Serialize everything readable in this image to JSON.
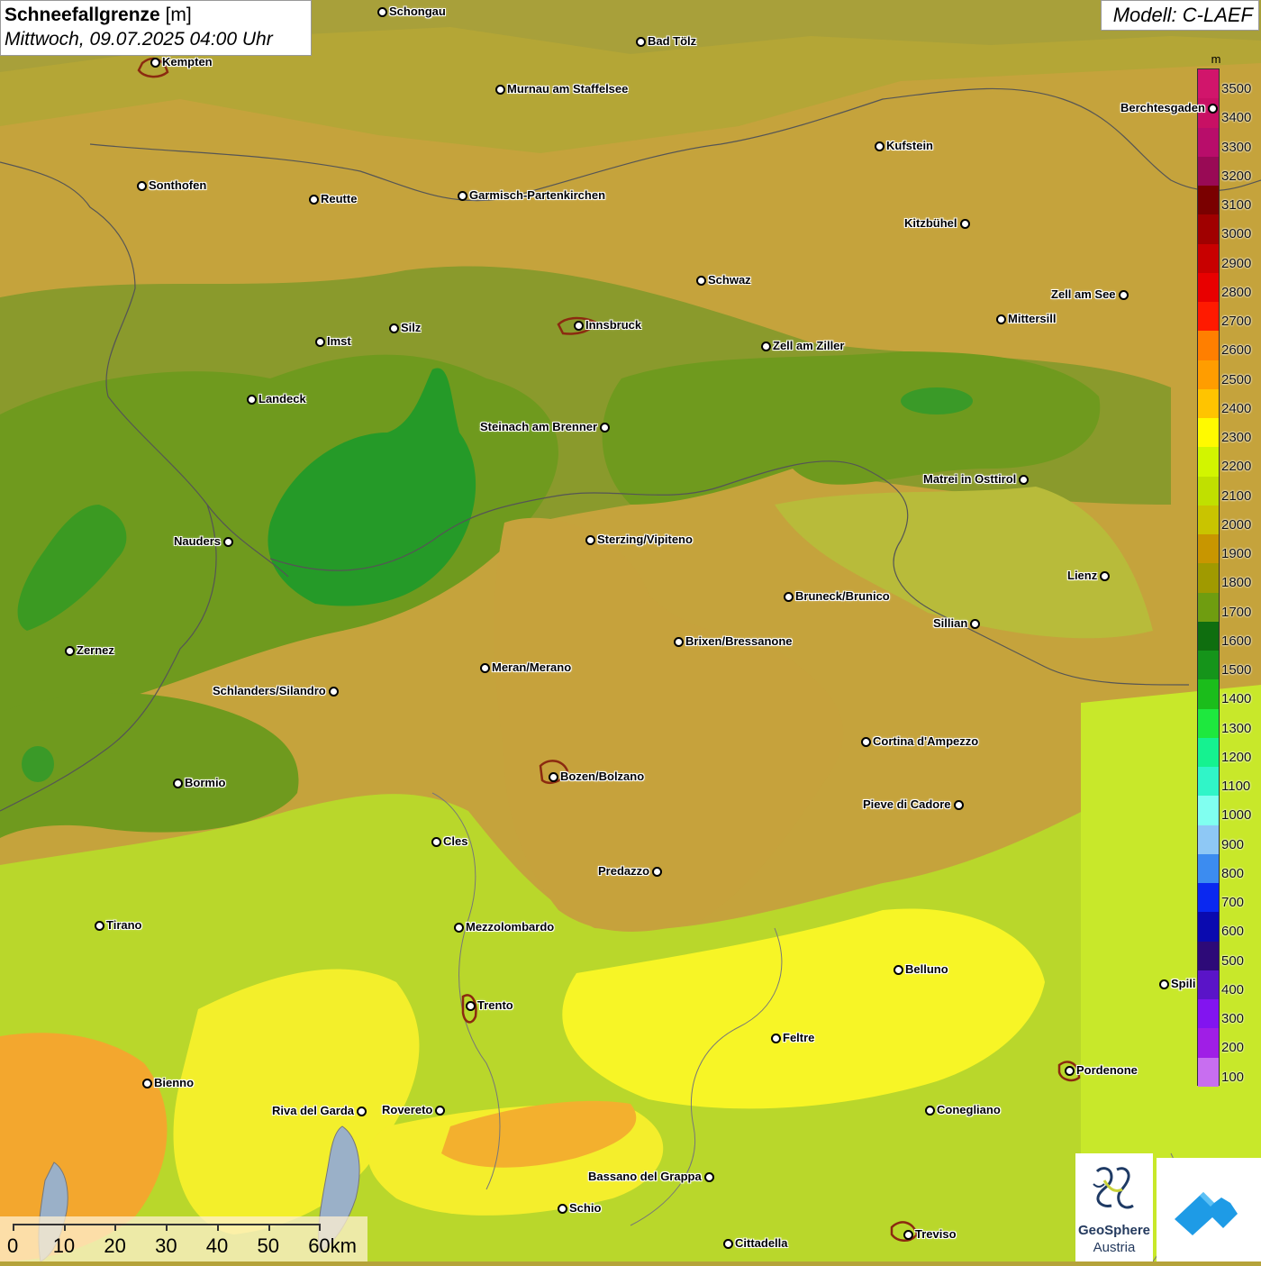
{
  "header": {
    "title": "Schneefallgrenze",
    "unit": "[m]",
    "datetime": "Mittwoch, 09.07.2025 04:00 Uhr",
    "model": "Modell: C-LAEF"
  },
  "legend": {
    "unit": "m",
    "levels": [
      {
        "label": "3500",
        "color": "#d1156b"
      },
      {
        "label": "3400",
        "color": "#c81064"
      },
      {
        "label": "3300",
        "color": "#b80d6a"
      },
      {
        "label": "3200",
        "color": "#990a55"
      },
      {
        "label": "3100",
        "color": "#7a0000"
      },
      {
        "label": "3000",
        "color": "#a00000"
      },
      {
        "label": "2900",
        "color": "#c80000"
      },
      {
        "label": "2800",
        "color": "#e80000"
      },
      {
        "label": "2700",
        "color": "#ff1a00"
      },
      {
        "label": "2600",
        "color": "#ff7f00"
      },
      {
        "label": "2500",
        "color": "#ff9d00"
      },
      {
        "label": "2400",
        "color": "#ffc400"
      },
      {
        "label": "2300",
        "color": "#fffa00"
      },
      {
        "label": "2200",
        "color": "#d2f500"
      },
      {
        "label": "2100",
        "color": "#c0e000"
      },
      {
        "label": "2000",
        "color": "#c9c400"
      },
      {
        "label": "1900",
        "color": "#c89600"
      },
      {
        "label": "1800",
        "color": "#a09a00"
      },
      {
        "label": "1700",
        "color": "#6f9d10"
      },
      {
        "label": "1600",
        "color": "#0f6e0f"
      },
      {
        "label": "1500",
        "color": "#15941a"
      },
      {
        "label": "1400",
        "color": "#1bbd1b"
      },
      {
        "label": "1300",
        "color": "#1ee83e"
      },
      {
        "label": "1200",
        "color": "#15f290"
      },
      {
        "label": "1100",
        "color": "#30f5c8"
      },
      {
        "label": "1000",
        "color": "#80fff0"
      },
      {
        "label": "900",
        "color": "#8ec8f5"
      },
      {
        "label": "800",
        "color": "#3c8cf0"
      },
      {
        "label": "700",
        "color": "#0a28f0"
      },
      {
        "label": "600",
        "color": "#0a0aaf"
      },
      {
        "label": "500",
        "color": "#2d0a78"
      },
      {
        "label": "400",
        "color": "#5a14c8"
      },
      {
        "label": "300",
        "color": "#8214f0"
      },
      {
        "label": "200",
        "color": "#a01ee6"
      },
      {
        "label": "100",
        "color": "#c86ef0"
      }
    ]
  },
  "cities": [
    {
      "name": "Schongau"
    },
    {
      "name": "Bad Tölz"
    },
    {
      "name": "Kempten"
    },
    {
      "name": "Murnau am Staffelsee"
    },
    {
      "name": "Berchtesgaden"
    },
    {
      "name": "Kufstein"
    },
    {
      "name": "Sonthofen"
    },
    {
      "name": "Reutte"
    },
    {
      "name": "Garmisch-Partenkirchen"
    },
    {
      "name": "Kitzbühel"
    },
    {
      "name": "Schwaz"
    },
    {
      "name": "Zell am See"
    },
    {
      "name": "Mittersill"
    },
    {
      "name": "Innsbruck"
    },
    {
      "name": "Imst"
    },
    {
      "name": "Silz"
    },
    {
      "name": "Zell am Ziller"
    },
    {
      "name": "Landeck"
    },
    {
      "name": "Steinach am Brenner"
    },
    {
      "name": "Matrei in Osttirol"
    },
    {
      "name": "Nauders"
    },
    {
      "name": "Sterzing/Vipiteno"
    },
    {
      "name": "Lienz"
    },
    {
      "name": "Bruneck/Brunico"
    },
    {
      "name": "Sillian"
    },
    {
      "name": "Zernez"
    },
    {
      "name": "Brixen/Bressanone"
    },
    {
      "name": "Meran/Merano"
    },
    {
      "name": "Schlanders/Silandro"
    },
    {
      "name": "Cortina d'Ampezzo"
    },
    {
      "name": "Bozen/Bolzano"
    },
    {
      "name": "Bormio"
    },
    {
      "name": "Pieve di Cadore"
    },
    {
      "name": "Cles"
    },
    {
      "name": "Predazzo"
    },
    {
      "name": "Tirano"
    },
    {
      "name": "Mezzolombardo"
    },
    {
      "name": "Belluno"
    },
    {
      "name": "Spili"
    },
    {
      "name": "Trento"
    },
    {
      "name": "Feltre"
    },
    {
      "name": "Pordenone"
    },
    {
      "name": "Bienno"
    },
    {
      "name": "Riva del Garda"
    },
    {
      "name": "Rovereto"
    },
    {
      "name": "Conegliano"
    },
    {
      "name": "Bassano del Grappa"
    },
    {
      "name": "Schio"
    },
    {
      "name": "Treviso"
    },
    {
      "name": "Cittadella"
    }
  ],
  "scale": {
    "labels": [
      "0",
      "10",
      "20",
      "30",
      "40",
      "50",
      "60km"
    ]
  },
  "logo": {
    "name": "GeoSphere",
    "country": "Austria"
  }
}
